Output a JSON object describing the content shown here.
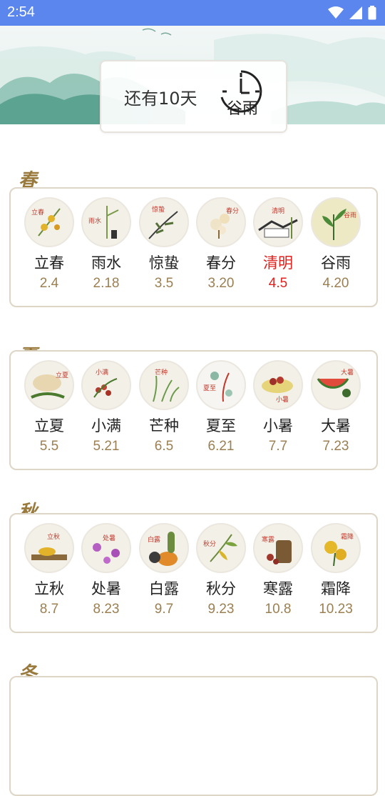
{
  "status_bar": {
    "time": "2:54"
  },
  "countdown": {
    "text": "还有10天",
    "term": "谷雨"
  },
  "colors": {
    "status_bar": "#5b86ee",
    "highlight": "#e0211e",
    "date": "#9b7f51",
    "season_mark": "#9a7a3c",
    "box_border": "#ddd5c6"
  },
  "seasons": [
    {
      "label": "春",
      "terms": [
        {
          "name": "立春",
          "date": "2.4",
          "active": false
        },
        {
          "name": "雨水",
          "date": "2.18",
          "active": false
        },
        {
          "name": "惊蛰",
          "date": "3.5",
          "active": false
        },
        {
          "name": "春分",
          "date": "3.20",
          "active": false
        },
        {
          "name": "清明",
          "date": "4.5",
          "active": true
        },
        {
          "name": "谷雨",
          "date": "4.20",
          "active": false
        }
      ]
    },
    {
      "label": "夏",
      "terms": [
        {
          "name": "立夏",
          "date": "5.5",
          "active": false
        },
        {
          "name": "小满",
          "date": "5.21",
          "active": false
        },
        {
          "name": "芒种",
          "date": "6.5",
          "active": false
        },
        {
          "name": "夏至",
          "date": "6.21",
          "active": false
        },
        {
          "name": "小暑",
          "date": "7.7",
          "active": false
        },
        {
          "name": "大暑",
          "date": "7.23",
          "active": false
        }
      ]
    },
    {
      "label": "秋",
      "terms": [
        {
          "name": "立秋",
          "date": "8.7",
          "active": false
        },
        {
          "name": "处暑",
          "date": "8.23",
          "active": false
        },
        {
          "name": "白露",
          "date": "9.7",
          "active": false
        },
        {
          "name": "秋分",
          "date": "9.23",
          "active": false
        },
        {
          "name": "寒露",
          "date": "10.8",
          "active": false
        },
        {
          "name": "霜降",
          "date": "10.23",
          "active": false
        }
      ]
    },
    {
      "label": "冬",
      "terms": []
    }
  ]
}
